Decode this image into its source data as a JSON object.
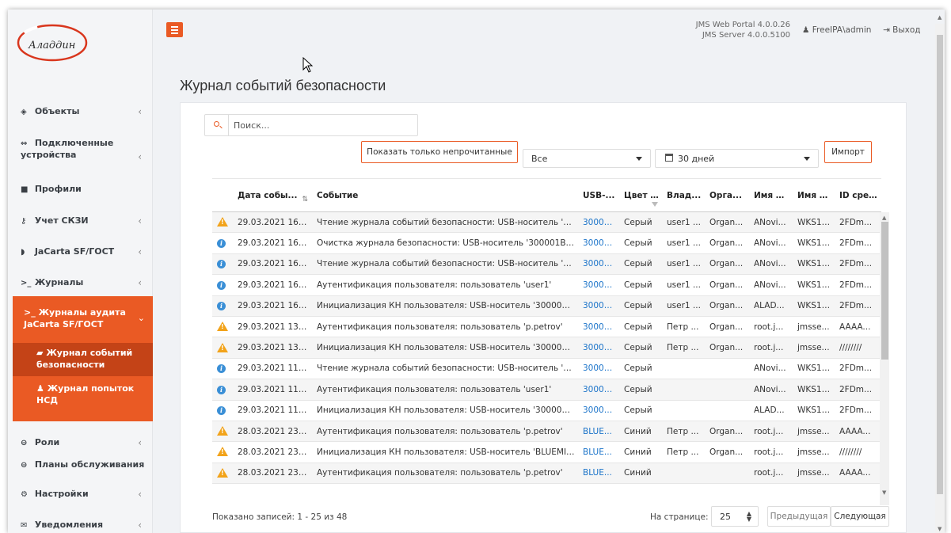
{
  "brand": {
    "logo_text": "Аладдин",
    "accent": "#ea5a24",
    "sidebar_active": "#c44317",
    "link": "#1a73c9",
    "info_icon": "#3a8fd6",
    "warn_icon": "#f2a31a"
  },
  "header": {
    "version_line1": "JMS Web Portal   4.0.0.26",
    "version_line2": "JMS Server   4.0.0.5100",
    "user": "FreeIPA\\admin",
    "logout": "Выход"
  },
  "sidebar": {
    "items": [
      {
        "label": "Объекты",
        "icon": "diamond-icon"
      },
      {
        "label_line1": "Подключенные",
        "label_line2": "устройства",
        "icon": "plug-icon"
      },
      {
        "label": "Профили",
        "icon": "folder-icon"
      },
      {
        "label": "Учет СКЗИ",
        "icon": "key-icon"
      },
      {
        "label": "JaCarta SF/ГОСТ",
        "icon": "shield-icon"
      },
      {
        "label": "Журналы",
        "icon": "terminal-icon"
      },
      {
        "label_line1": "Журналы аудита",
        "label_line2": "JaCarta SF/ГОСТ",
        "icon": "terminal-icon"
      },
      {
        "label_line1": "Журнал событий",
        "label_line2": "безопасности",
        "icon": "book-icon"
      },
      {
        "label_line1": "Журнал попыток",
        "label_line2": "НСД",
        "icon": "user-icon"
      },
      {
        "label": "Роли",
        "icon": "user-circle-icon"
      },
      {
        "label": "Планы обслуживания",
        "icon": "user-circle-icon"
      },
      {
        "label": "Настройки",
        "icon": "gears-icon"
      },
      {
        "label": "Уведомления",
        "icon": "envelope-icon"
      }
    ]
  },
  "page": {
    "title": "Журнал событий безопасности"
  },
  "toolbar": {
    "search_placeholder": "Поиск...",
    "unread_button": "Показать только непрочитанные",
    "filter_select": "Все",
    "period_select": "30 дней",
    "import_button": "Импорт"
  },
  "table": {
    "columns": [
      "",
      "Дата собы...",
      "Событие",
      "USB-...",
      "Цвет ...",
      "Влад...",
      "Орга...",
      "Имя п...",
      "Имя к...",
      "ID сре..."
    ],
    "rows": [
      {
        "type": "warn",
        "cells": [
          "29.03.2021 16:3...",
          "Чтение журнала событий безопасности: USB-носитель '30...",
          "30000...",
          "Серый",
          "user1 ...",
          "Organ...",
          "ANovi...",
          "WKS171",
          "2FDm..."
        ]
      },
      {
        "type": "info",
        "cells": [
          "29.03.2021 16:3...",
          "Очистка журнала безопасности: USB-носитель '300001B7', ...",
          "30000...",
          "Серый",
          "user1 ...",
          "Organ...",
          "ANovi...",
          "WKS171",
          "2FDm..."
        ]
      },
      {
        "type": "info",
        "cells": [
          "29.03.2021 16:3...",
          "Чтение журнала событий безопасности: USB-носитель '30...",
          "30000...",
          "Серый",
          "user1 ...",
          "Organ...",
          "ANovi...",
          "WKS171",
          "2FDm..."
        ]
      },
      {
        "type": "info",
        "cells": [
          "29.03.2021 16:3...",
          "Аутентификация пользователя: пользователь 'user1'",
          "30000...",
          "Серый",
          "user1 ...",
          "Organ...",
          "ANovi...",
          "WKS171",
          "2FDm..."
        ]
      },
      {
        "type": "info",
        "cells": [
          "29.03.2021 16:3...",
          "Инициализация КН пользователя: USB-носитель '300001B7...",
          "30000...",
          "Серый",
          "user1 ...",
          "Organ...",
          "ALAD...",
          "WKS171",
          "2FDm..."
        ]
      },
      {
        "type": "warn",
        "cells": [
          "29.03.2021 13:1...",
          "Аутентификация пользователя: пользователь 'p.petrov'",
          "30000...",
          "Серый",
          "Петр ...",
          "Organ...",
          "root.j...",
          "jmsse...",
          "AAAA..."
        ]
      },
      {
        "type": "warn",
        "cells": [
          "29.03.2021 13:1...",
          "Инициализация КН пользователя: USB-носитель '300001D...",
          "30000...",
          "Серый",
          "Петр ...",
          "Organ...",
          "root.j...",
          "jmsse...",
          "////////"
        ]
      },
      {
        "type": "info",
        "cells": [
          "29.03.2021 11:4...",
          "Чтение журнала событий безопасности: USB-носитель '30...",
          "30000...",
          "Серый",
          "",
          "",
          "ANovi...",
          "WKS171",
          "2FDm..."
        ]
      },
      {
        "type": "info",
        "cells": [
          "29.03.2021 11:4...",
          "Аутентификация пользователя: пользователь 'user1'",
          "30000...",
          "Серый",
          "",
          "",
          "ANovi...",
          "WKS171",
          "2FDm..."
        ]
      },
      {
        "type": "info",
        "cells": [
          "29.03.2021 11:4...",
          "Инициализация КН пользователя: USB-носитель '300001A...",
          "30000...",
          "Серый",
          "",
          "",
          "ALAD...",
          "WKS171",
          "2FDm..."
        ]
      },
      {
        "type": "warn",
        "cells": [
          "28.03.2021 23:2...",
          "Аутентификация пользователя: пользователь 'p.petrov'",
          "BLUE...",
          "Синий",
          "Петр ...",
          "Organ...",
          "root.j...",
          "jmsse...",
          "AAAA..."
        ]
      },
      {
        "type": "warn",
        "cells": [
          "28.03.2021 23:2...",
          "Инициализация КН пользователя: USB-носитель 'BLUEMIL...",
          "BLUE...",
          "Синий",
          "Петр ...",
          "Organ...",
          "root.j...",
          "jmsse...",
          "////////"
        ]
      },
      {
        "type": "warn",
        "cells": [
          "28.03.2021 23:2...",
          "Аутентификация пользователя: пользователь 'p.petrov'",
          "BLUE...",
          "Синий",
          "",
          "",
          "root.j...",
          "jmsse...",
          "AAAA..."
        ]
      }
    ]
  },
  "footer": {
    "status": "Показано записей: 1 - 25 из 48",
    "per_page_label": "На странице:",
    "per_page_value": "25",
    "prev": "Предыдущая",
    "next": "Следующая"
  }
}
